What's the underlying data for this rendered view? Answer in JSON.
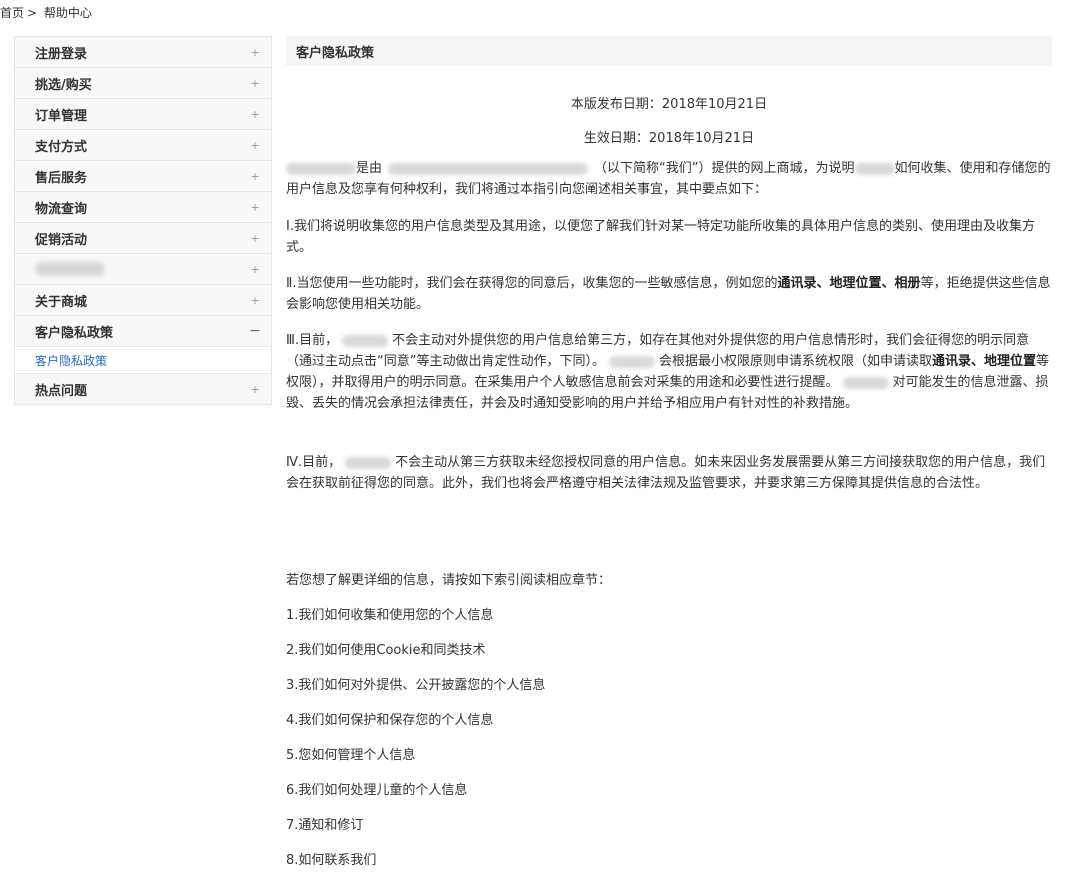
{
  "breadcrumb": {
    "home": "首页",
    "separator": ">",
    "current": "帮助中心"
  },
  "sidebar": {
    "items": [
      {
        "label": "注册登录",
        "sign": "+"
      },
      {
        "label": "挑选/购买",
        "sign": "+"
      },
      {
        "label": "订单管理",
        "sign": "+"
      },
      {
        "label": "支付方式",
        "sign": "+"
      },
      {
        "label": "售后服务",
        "sign": "+"
      },
      {
        "label": "物流查询",
        "sign": "+"
      },
      {
        "label": "促销活动",
        "sign": "+"
      },
      {
        "label": "",
        "sign": "+"
      },
      {
        "label": "关于商城",
        "sign": "+"
      },
      {
        "label": "客户隐私政策",
        "sign": "−"
      },
      {
        "label": "热点问题",
        "sign": "+"
      }
    ],
    "sub_item": "客户隐私政策"
  },
  "content": {
    "title": "客户隐私政策",
    "release_date": "本版发布日期：2018年10月21日",
    "effective_date": "生效日期：2018年10月21日",
    "intro": {
      "a": "是由",
      "b": "（以下简称“我们”）提供的网上商城，为说明",
      "c": "如何收集、使用和存储您的用户信息及您享有何种权利，我们将通过本指引向您阐述相关事宜，其中要点如下："
    },
    "p1": "Ⅰ.我们将说明收集您的用户信息类型及其用途，以便您了解我们针对某一特定功能所收集的具体用户信息的类别、使用理由及收集方式。",
    "p2": {
      "a": "Ⅱ.当您使用一些功能时，我们会在获得您的同意后，收集您的一些敏感信息，例如您的",
      "bold": "通讯录、地理位置、相册",
      "b": "等，拒绝提供这些信息会影响您使用相关功能。"
    },
    "p3": {
      "a": "Ⅲ.目前，",
      "b": "不会主动对外提供您的用户信息给第三方，如存在其他对外提供您的用户信息情形时，我们会征得您的明示同意（通过主动点击“同意”等主动做出肯定性动作，下同）。",
      "c": "会根据最小权限原则申请系统权限（如申请读取",
      "bold": "通讯录、地理位置",
      "d": "等权限），并取得用户的明示同意。在采集用户个人敏感信息前会对采集的用途和必要性进行提醒。",
      "e": "对可能发生的信息泄露、损毁、丢失的情况会承担法律责任，并会及时通知受影响的用户并给予相应用户有针对性的补救措施。"
    },
    "p4": {
      "a": "Ⅳ.目前，",
      "b": "不会主动从第三方获取未经您授权同意的用户信息。如未来因业务发展需要从第三方间接获取您的用户信息，我们会在获取前征得您的同意。此外，我们也将会严格遵守相关法律法规及监管要求，并要求第三方保障其提供信息的合法性。"
    },
    "toc_intro": "若您想了解更详细的信息，请按如下索引阅读相应章节：",
    "toc": [
      "1.我们如何收集和使用您的个人信息",
      "2.我们如何使用Cookie和同类技术",
      "3.我们如何对外提供、公开披露您的个人信息",
      "4.我们如何保护和保存您的个人信息",
      "5.您如何管理个人信息",
      "6.我们如何处理儿童的个人信息",
      "7.通知和修订",
      "8.如何联系我们"
    ]
  }
}
